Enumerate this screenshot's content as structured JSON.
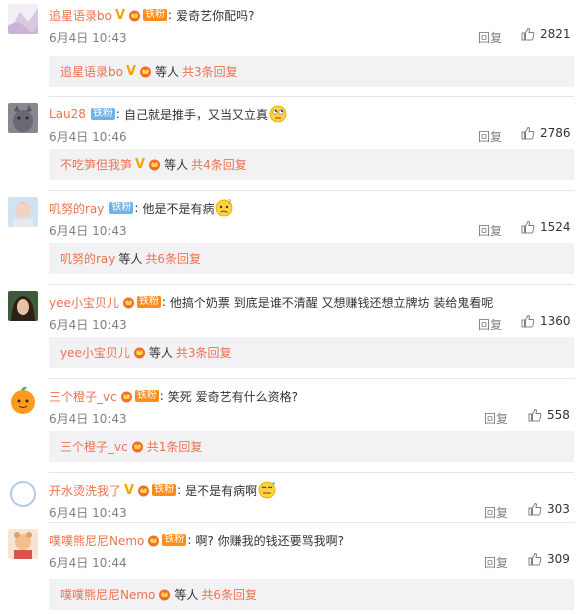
{
  "comments": [
    {
      "user": "追星语录bo",
      "verified": "V",
      "fan": "铁粉",
      "text": "爱奇艺你配吗?",
      "time": "6月4日 10:43",
      "reply": "回复",
      "likes": "2821",
      "sub": {
        "user": "追星语录bo",
        "etc": "等人",
        "total": "共3条回复"
      }
    },
    {
      "user": "Lau28",
      "fan": "铁粉",
      "text": "自己就是推手，又当又立真",
      "time": "6月4日 10:46",
      "reply": "回复",
      "likes": "2786",
      "sub": {
        "user": "不吃笋但我笋",
        "etc": "等人",
        "total": "共4条回复"
      }
    },
    {
      "user": "叽努的ray",
      "fan": "铁粉",
      "text": "他是不是有病",
      "time": "6月4日 10:43",
      "reply": "回复",
      "likes": "1524",
      "sub": {
        "user": "叽努的ray",
        "etc": "等人",
        "total": "共6条回复"
      }
    },
    {
      "user": "yee小宝贝儿",
      "fan": "铁粉",
      "text": "他搞个奶票 到底是谁不清醒 又想赚钱还想立牌坊 装给鬼看呢",
      "time": "6月4日 10:43",
      "reply": "回复",
      "likes": "1360",
      "sub": {
        "user": "yee小宝贝儿",
        "etc": "等人",
        "total": "共3条回复"
      }
    },
    {
      "user": "三个橙子_vc",
      "fan": "铁粉",
      "text": "笑死 爱奇艺有什么资格?",
      "time": "6月4日 10:43",
      "reply": "回复",
      "likes": "558",
      "sub": {
        "user": "三个橙子_vc",
        "etc": "",
        "total": "共1条回复"
      }
    },
    {
      "user": "开水烫洗我了",
      "verified": "V",
      "fan": "铁粉",
      "text": "是不是有病啊",
      "time": "6月4日 10:43",
      "reply": "回复",
      "likes": "303"
    },
    {
      "user": "噗噗熊尼尼Nemo",
      "fan": "铁粉",
      "text": "啊? 你赚我的钱还要骂我啊?",
      "time": "6月4日 10:44",
      "reply": "回复",
      "likes": "309",
      "sub": {
        "user": "噗噗熊尼尼Nemo",
        "etc": "等人",
        "total": "共6条回复"
      }
    }
  ],
  "icons": {
    "like": "thumbs-up-icon",
    "member": "vip-crown-icon",
    "emoji_eyeroll": "eye-roll-emoji",
    "emoji_confused": "confused-emoji",
    "emoji_doh": "doh-emoji"
  },
  "colors": {
    "username": "#eb7350",
    "meta": "#808080",
    "fan_badge": "#ff8c1a",
    "fan_badge_blue": "#6fb2e8",
    "sub_background": "#f2f2f5"
  }
}
